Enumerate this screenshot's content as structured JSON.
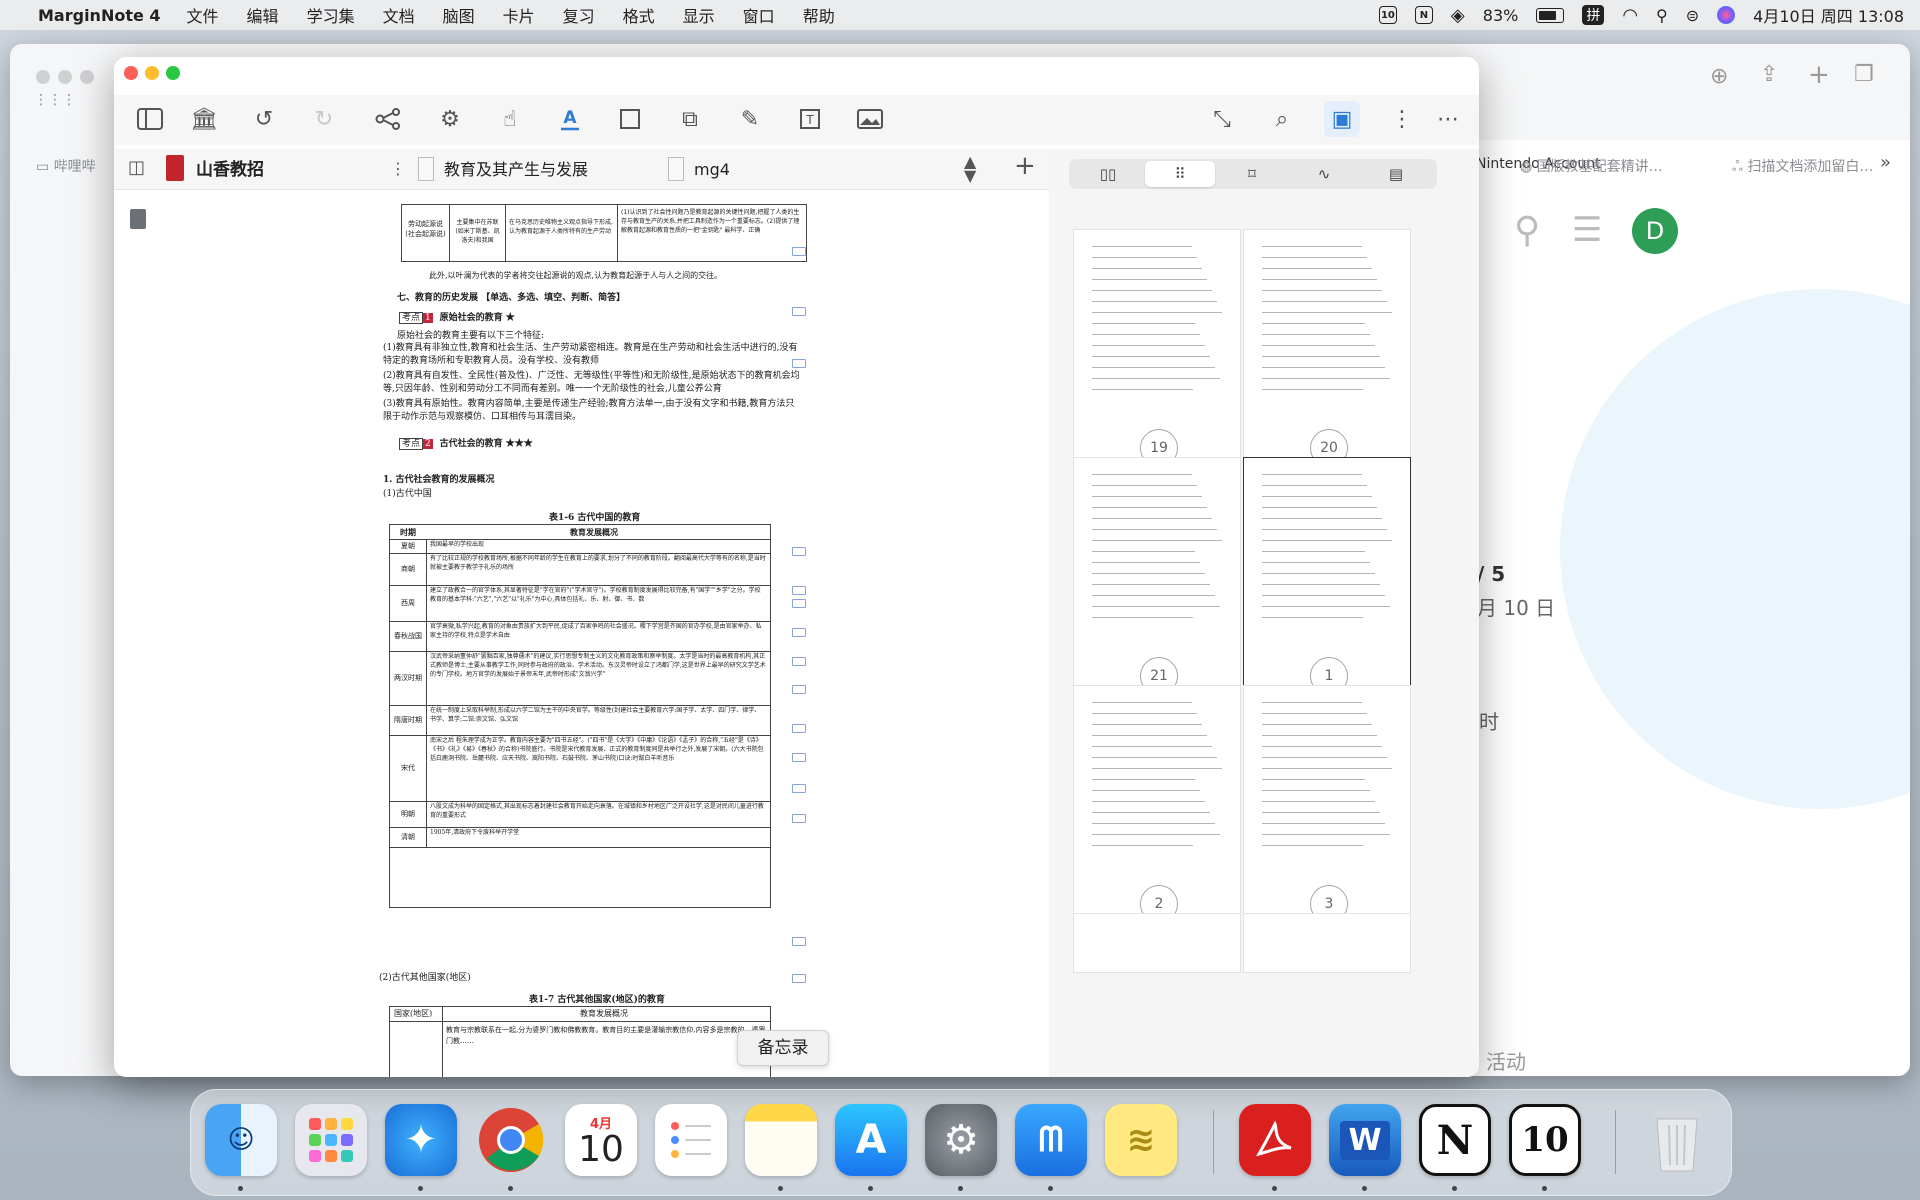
{
  "menubar": {
    "app_name": "MarginNote 4",
    "items": [
      "文件",
      "编辑",
      "学习集",
      "文档",
      "脑图",
      "卡片",
      "复习",
      "格式",
      "显示",
      "窗口",
      "帮助"
    ],
    "battery": "83%",
    "input_method": "拼",
    "calendar_icon_day": "10",
    "notion_glyph": "N",
    "datetime": "4月10日 周四  13:08"
  },
  "background_browser": {
    "bookmark_text": "Nintendo Account",
    "tabs": [
      "哔哩哔",
      "国版教基配套精讲…",
      "扫描文档添加留白…"
    ],
    "page_frag_1": "/ 5",
    "page_frag_2": "月 10 日",
    "page_frag_3": "时",
    "page_frag_4": "活动",
    "avatar_letter": "D"
  },
  "toolbar": {
    "icons": [
      "sidebar-icon",
      "library-icon",
      "undo-icon",
      "redo-icon",
      "mindmap-icon",
      "gear-icon",
      "hand-icon",
      "text-highlight-icon",
      "select-rect-icon",
      "crop-icon",
      "pen-icon",
      "text-box-icon",
      "image-icon",
      "collapse-icon",
      "search-document-icon",
      "bookmark-panel-icon",
      "more-vertical-icon",
      "more-horizontal-icon"
    ]
  },
  "tabs": {
    "notebook": "山香教招",
    "doc_1": "教育及其产生与发展",
    "doc_2": "mg4"
  },
  "pdf": {
    "row_a_col1": "劳动起源说\n(社会起源说)",
    "row_a_col2": "主要集中在苏联\n(如米丁斯基、凯\n洛夫)和我国",
    "row_a_col3": "在马克思历史唯物主义观点指导下形成,认为教育起源于人类所特有的生产劳动",
    "row_a_col4": "(1)认识到了社会性问题乃是教育起源的关键性问题,把握了人类的生存与教育生产的关系,并把工具制造作为一个重要标志。(2)提供了理解教育起源和教育性质的一把\"金钥匙\" 最科学、正确",
    "note_line": "此外,以叶澜为代表的学者将交往起源说的观点,认为教育起源于人与人之间的交往。",
    "section_7": "七、教育的历史发展 【单选、多选、填空、判断、简答】",
    "kaodian_1_label": "考点",
    "kaodian_1_num": "1",
    "kaodian_1_title": "原始社会的教育 ★",
    "primitive_intro": "原始社会的教育主要有以下三个特征:",
    "primitive_1": "(1)教育具有非独立性,教育和社会生活、生产劳动紧密相连。教育是在生产劳动和社会生活中进行的,没有特定的教育场所和专职教育人员。没有学校、没有教师",
    "primitive_2": "(2)教育具有自发性、全民性(普及性)、广泛性、无等级性(平等性)和无阶级性,是原始状态下的教育机会均等,只因年龄、性别和劳动分工不同而有差别。唯一一个无阶级性的社会,儿童公养公育",
    "primitive_3": "(3)教育具有原始性。教育内容简单,主要是传递生产经验;教育方法单一,由于没有文字和书籍,教育方法只限于动作示范与观察模仿、口耳相传与耳濡目染。",
    "kaodian_2_label": "考点",
    "kaodian_2_num": "2",
    "kaodian_2_title": "古代社会的教育 ★★★",
    "ancient_heading": "1. 古代社会教育的发展概况",
    "ancient_china": "(1)古代中国",
    "table_1_title": "表1-6  古代中国的教育",
    "table_1_head": [
      "时期",
      "教育发展概况"
    ],
    "table_1_rows": [
      [
        "夏朝",
        "我国最早的学校出现"
      ],
      [
        "商朝",
        "有了比较正规的学校教育场所,根据不同年龄的学生在教育上的要求,划分了不同的教育阶段。翻阅最高代大学等有的名称,是当时就被主要教于教学于礼乐的场所"
      ],
      [
        "西周",
        "建立了政教合一的官学体系,其显著特征是\"学在官府\"(\"学术官守\")。学校教育制度发展得比较完备,有\"国学\"\"乡学\"之分。学校教育的基本学科:\"六艺\",\"六艺\"以\"礼乐\"为中心,具体包括礼、乐、射、御、书、数"
      ],
      [
        "春秋战国",
        "官学衰微,私学兴起,教育的对象由贵族扩大到平民,促成了百家争鸣的社会盛况。稷下学宫是齐国的官办学校,是由官家举办、私家主持的学校,特点是学术自由"
      ],
      [
        "两汉时期",
        "汉武帝采纳董仲舒\"罢黜百家,独尊儒术\"的建议,实行思想专制主义的文化教育政策和察举制度。太学是当时的最高教育机构,其正式教师是博士,主要从事教学工作,同时参与政府的政治、学术活动。东汉灵帝时设立了鸿都门学,这是世界上最早的研究文学艺术的专门学校。地方官学的发展始于景帝末年,武帝时形成\"文翁兴学\""
      ],
      [
        "隋唐时期",
        "在统一制度上采取科举制,形成以六学二馆为主干的中央官学。等级性(封建社会主要教育六学:国子学、太学、四门学、律学、书学、算学;二馆:崇文馆、弘文馆"
      ],
      [
        "宋代",
        "南宋之后 程朱理学成为正学。教育内容主要为\"四书五经\"。(\"四书\"是《大学》《中庸》《论语》《孟子》的合称,\"五经\"是《诗》《书》《礼》《易》《春秋》的合称)书院盛行。书院是宋代教育发展、正式的教育制度同是共举行之外,发展了宋朝。(六大书院包括白鹿洞书院、岳麓书院、应天书院、嵩阳书院、石鼓书院、茅山书院)口诀:时幫白羊听音乐"
      ],
      [
        "明朝",
        "八股文成为科举的固定格式,其出现标志着封建社会教育开始走向衰落。在城镇和乡村地区广泛开设社学,这是对民间儿童进行教育的重要形式"
      ],
      [
        "清朝",
        "1905年,清政府下令废科举开学堂"
      ]
    ],
    "ancient_other": "(2)古代其他国家(地区)",
    "table_2_title": "表1-7  古代其他国家(地区)的教育",
    "table_2_head": [
      "国家(地区)",
      "教育发展概况"
    ],
    "table_2_row": "教育与宗教联系在一起,分为婆罗门教和佛教教育。教育目的主要是灌输宗教信仰,内容多是宗教的。婆罗门教……"
  },
  "thumbnails": [
    "19",
    "20",
    "21",
    "1",
    "2",
    "3"
  ],
  "tooltip": "备忘录",
  "dock": {
    "calendar_month": "4月",
    "calendar_day": "10",
    "apps": [
      "finder",
      "launchpad",
      "safari",
      "chrome",
      "calendar",
      "reminders",
      "notes",
      "app-store",
      "system-settings",
      "marginnote",
      "stickies",
      "acrobat",
      "word",
      "notion",
      "marginnote-10",
      "trash"
    ],
    "word_letter": "W",
    "notion_letter": "N",
    "app10_text": "10"
  }
}
